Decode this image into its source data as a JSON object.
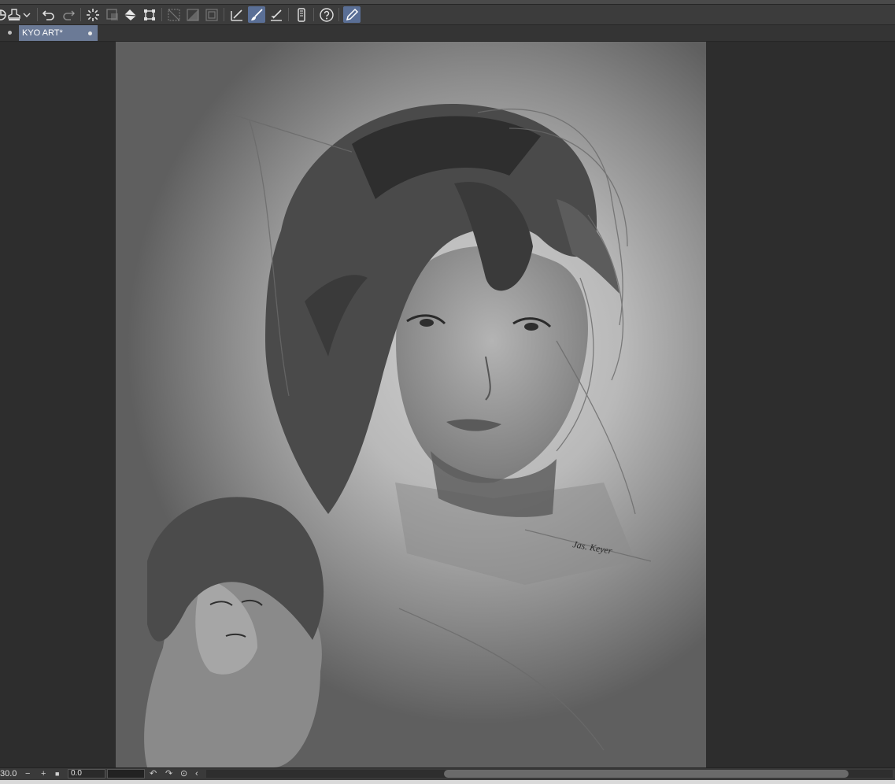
{
  "document_tab": {
    "name": "KYO ART*"
  },
  "status": {
    "zoom": "30.0",
    "angle": "0.0"
  },
  "signature_text": "Jas. Keyer",
  "toolbar_icons": [
    "clip-studio-icon",
    "stamp-icon",
    "dropdown-chevron-icon",
    "undo-icon",
    "redo-icon",
    "loading-spinner-icon",
    "clear-icon",
    "fill-icon",
    "transform-icon",
    "select-invert-icon",
    "select-off-icon",
    "select-border-icon",
    "correction-pen-icon",
    "brush-icon",
    "ruler-pen-icon",
    "smartphone-icon",
    "help-icon",
    "pen-pressure-icon"
  ],
  "colors": {
    "tab_active": "#6b7a96",
    "toolbar_active": "#5a6f96",
    "workspace": "#2d2d2d"
  }
}
